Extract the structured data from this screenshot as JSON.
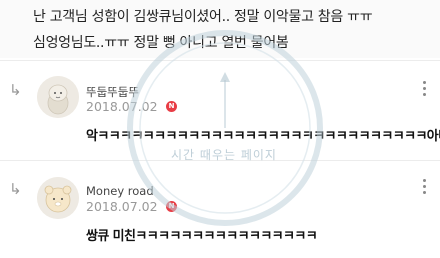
{
  "original_post": {
    "line1": "난 고객님 성함이 김쌍큐님이셨어.. 정말 이악물고 참음 ㅠㅠ",
    "line2": "심엉엉님도..ㅠㅠ 정말 뻥 아니고 열번 물어봄"
  },
  "comments": [
    {
      "author": "뚜둡뚜둡뚜",
      "date": "2018.07.02",
      "badge": "N",
      "text": "악ㅋㅋㅋㅋㅋㅋㅋㅋㅋㅋㅋㅋㅋㅋㅋㅋㅋㅋㅋㅋㅋㅋㅋㅋㅋㅋㅋㅋㅋ아미친"
    },
    {
      "author": "Money road",
      "date": "2018.07.02",
      "badge": "N",
      "text": "쌍큐 미친ㅋㅋㅋㅋㅋㅋㅋㅋㅋㅋㅋㅋㅋㅋㅋㅋ"
    }
  ],
  "watermark": {
    "text": "시간 때우는 페이지"
  },
  "icons": {
    "reply": "reply-arrow-icon",
    "more": "more-vertical-icon",
    "new": "new-badge-icon"
  },
  "colors": {
    "new_badge": "#e83d45",
    "watermark": "#b3c6d1"
  }
}
